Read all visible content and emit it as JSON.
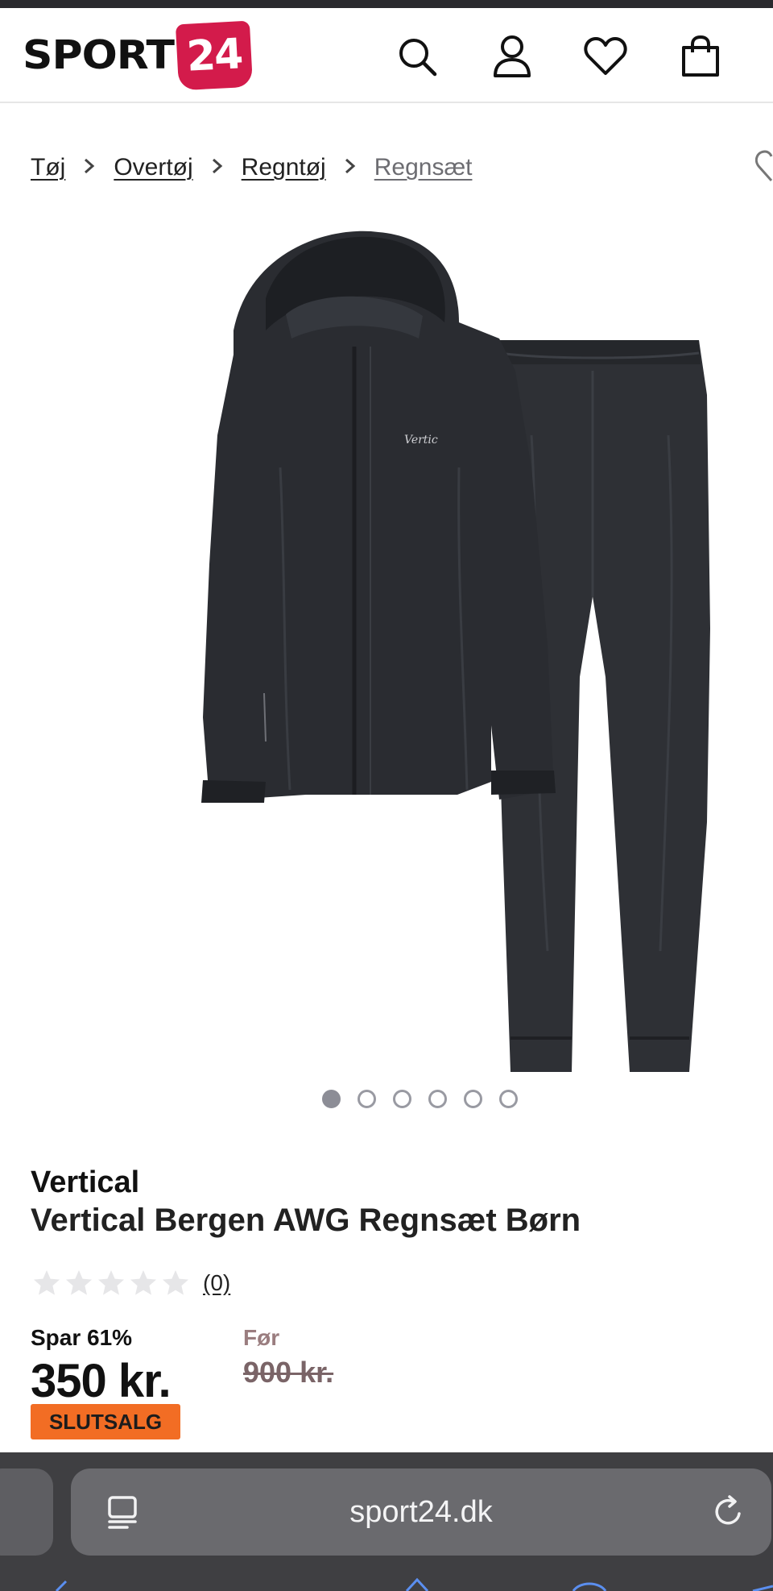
{
  "header": {
    "logo_text": "SPORT",
    "logo_badge": "24",
    "icons": [
      "search-icon",
      "user-icon",
      "heart-icon",
      "bag-icon"
    ]
  },
  "breadcrumb": {
    "items": [
      "Tøj",
      "Overtøj",
      "Regntøj",
      "Regnsæt"
    ]
  },
  "gallery": {
    "image_count": 6,
    "active_index": 0
  },
  "product": {
    "brand": "Vertical",
    "name": "Vertical Bergen AWG Regnsæt Børn",
    "rating": 0,
    "rating_max": 5,
    "review_count": "(0)",
    "save_label": "Spar 61%",
    "price": "350 kr.",
    "before_label": "Før",
    "before_price": "900 kr.",
    "badge": "SLUTSALG",
    "badge_color": "#f26d24"
  },
  "browser": {
    "url": "sport24.dk"
  },
  "colors": {
    "brand_red": "#d31b4b",
    "browser_bar": "#3f3f42"
  }
}
